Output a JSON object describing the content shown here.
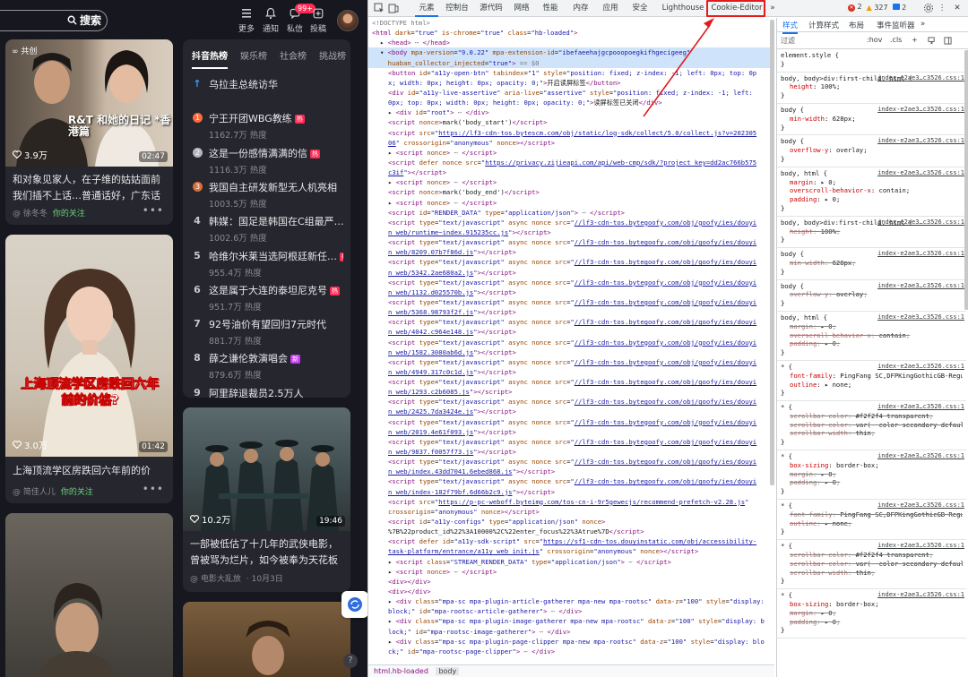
{
  "site": {
    "search_label": "搜索",
    "top_items": [
      {
        "icon": "more-icon",
        "label": "更多",
        "badge": ""
      },
      {
        "icon": "bell-icon",
        "label": "通知",
        "badge": ""
      },
      {
        "icon": "message-icon",
        "label": "私信",
        "badge": "99+"
      },
      {
        "icon": "upload-icon",
        "label": "投稿",
        "badge": ""
      }
    ],
    "cards": [
      {
        "tag": "共创",
        "likes": "3.9万",
        "duration": "02:47",
        "title": "和对象见家人，在子维的姑姑面前我们插不上话…普通话好，广东话好，…",
        "author": "@ 徐冬冬",
        "follow": "你的关注",
        "overlay": "R&T 和她的日记 *香港篇"
      },
      {
        "tag": "",
        "likes": "3.0万",
        "duration": "01:42",
        "title": "上海顶流学区房跌回六年前的价格?",
        "author": "@ 简佳人儿",
        "follow": "你的关注",
        "overlay": "上海顶流学区房跌回六年前的价格?"
      },
      {
        "tag": "",
        "likes": "10.2万",
        "duration": "19:46",
        "title": "一部被低估了十几年的武侠电影，曾被骂为烂片，如今被奉为天花板",
        "author": "@ 电影大乱放",
        "date": "· 10月3日",
        "follow": "",
        "overlay": ""
      }
    ],
    "hot": {
      "tabs": [
        "抖音热榜",
        "娱乐榜",
        "社会榜",
        "挑战榜"
      ],
      "items": [
        {
          "rank": "↑",
          "text": "乌拉圭总统访华",
          "heat": "",
          "badge": ""
        },
        {
          "rank": "1",
          "text": "宁王开团WBG教练",
          "heat": "1162.7万 热度",
          "badge": "热"
        },
        {
          "rank": "2",
          "text": "这是一份感情满满的信",
          "heat": "1116.3万 热度",
          "badge": "热"
        },
        {
          "rank": "3",
          "text": "我国自主研发新型无人机亮相",
          "heat": "1003.5万 热度",
          "badge": ""
        },
        {
          "rank": "4",
          "text": "韩媒：国足是韩国在C组最严…",
          "heat": "1002.6万 热度",
          "badge": ""
        },
        {
          "rank": "5",
          "text": "哈维尔米莱当选阿根廷新任…",
          "heat": "955.4万 热度",
          "badge": "热"
        },
        {
          "rank": "6",
          "text": "这是属于大连的泰坦尼克号",
          "heat": "951.7万 热度",
          "badge": "热"
        },
        {
          "rank": "7",
          "text": "92号油价有望回归7元时代",
          "heat": "881.7万 热度",
          "badge": ""
        },
        {
          "rank": "8",
          "text": "薛之谦伦敦演唱会",
          "heat": "879.6万 热度",
          "badge": "新"
        },
        {
          "rank": "9",
          "text": "阿里辞退裁员2.5万人",
          "heat": "",
          "badge": ""
        }
      ]
    }
  },
  "devtools": {
    "tabs": [
      "元素",
      "控制台",
      "源代码",
      "网络",
      "性能",
      "内存",
      "应用",
      "安全",
      "Lighthouse",
      "Cookie-Editor",
      "»"
    ],
    "status": {
      "errors": "2",
      "warnings": "327",
      "info": "2"
    },
    "breadcrumb": [
      "html.hb-loaded",
      "body"
    ],
    "styles_tabs": [
      "样式",
      "计算样式",
      "布局",
      "事件监听器",
      "»"
    ],
    "filter_placeholder": "过滤",
    "filter_buttons": [
      ":hov",
      ".cls",
      "+"
    ]
  }
}
